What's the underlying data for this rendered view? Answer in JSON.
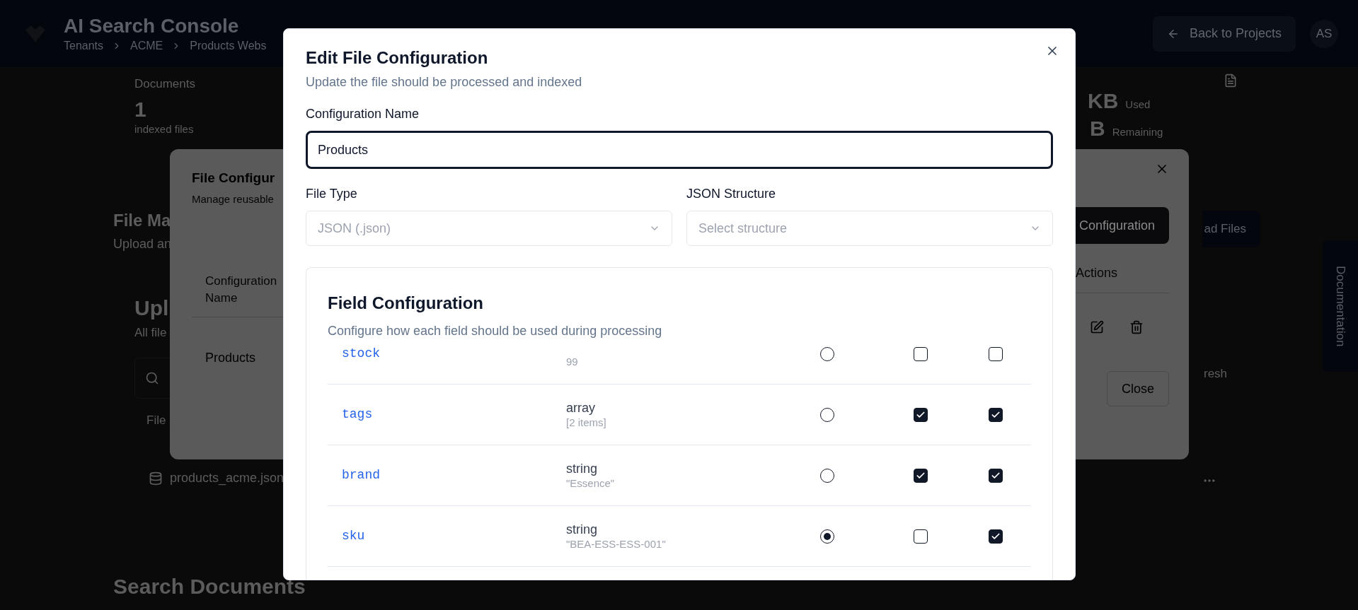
{
  "header": {
    "title": "AI Search Console",
    "breadcrumbs": [
      "Tenants",
      "ACME",
      "Products Webs"
    ],
    "back_button": "Back to Projects",
    "avatar": "AS"
  },
  "page": {
    "documents_label": "Documents",
    "documents_count": "1",
    "documents_caption": "indexed files",
    "storage_used_value": "KB",
    "storage_used_label": "Used",
    "storage_remaining_value": "B",
    "storage_remaining_label": "Remaining",
    "section_title": "File Ma",
    "section_subtitle": "Upload an",
    "upload_title": "Upl",
    "upload_subtitle": "All file",
    "files_label": "File",
    "file_name": "products_acme.json",
    "upload_button": "ad Files",
    "refresh_label": "resh",
    "search_title": "Search Documents",
    "documentation_tab": "Documentation"
  },
  "config_dialog": {
    "title": "File Configur",
    "subtitle": "Manage reusable",
    "new_button": "Configuration",
    "columns": [
      "Configuration Name",
      "Actions"
    ],
    "rows": [
      {
        "name": "Products"
      }
    ],
    "close_button": "Close"
  },
  "edit_dialog": {
    "title": "Edit File Configuration",
    "subtitle": "Update the file should be processed and indexed",
    "name_label": "Configuration Name",
    "name_value": "Products",
    "file_type_label": "File Type",
    "file_type": {
      "value": "JSON (.json)"
    },
    "structure_label": "JSON Structure",
    "structure": {
      "placeholder": "Select structure"
    },
    "field_config": {
      "title": "Field Configuration",
      "description": "Configure how each field should be used during processing",
      "fields": [
        {
          "name": "stock",
          "sample": "99",
          "selected": false,
          "option_1_checked": false,
          "option_2_checked": false
        },
        {
          "name": "tags",
          "type": "array",
          "sample": "[2 items]",
          "selected": false,
          "option_1_checked": true,
          "option_2_checked": true
        },
        {
          "name": "brand",
          "type": "string",
          "sample": "\"Essence\"",
          "selected": false,
          "option_1_checked": true,
          "option_2_checked": true
        },
        {
          "name": "sku",
          "type": "string",
          "sample": "\"BEA-ESS-ESS-001\"",
          "selected": true,
          "option_1_checked": false,
          "option_2_checked": true
        }
      ]
    }
  }
}
